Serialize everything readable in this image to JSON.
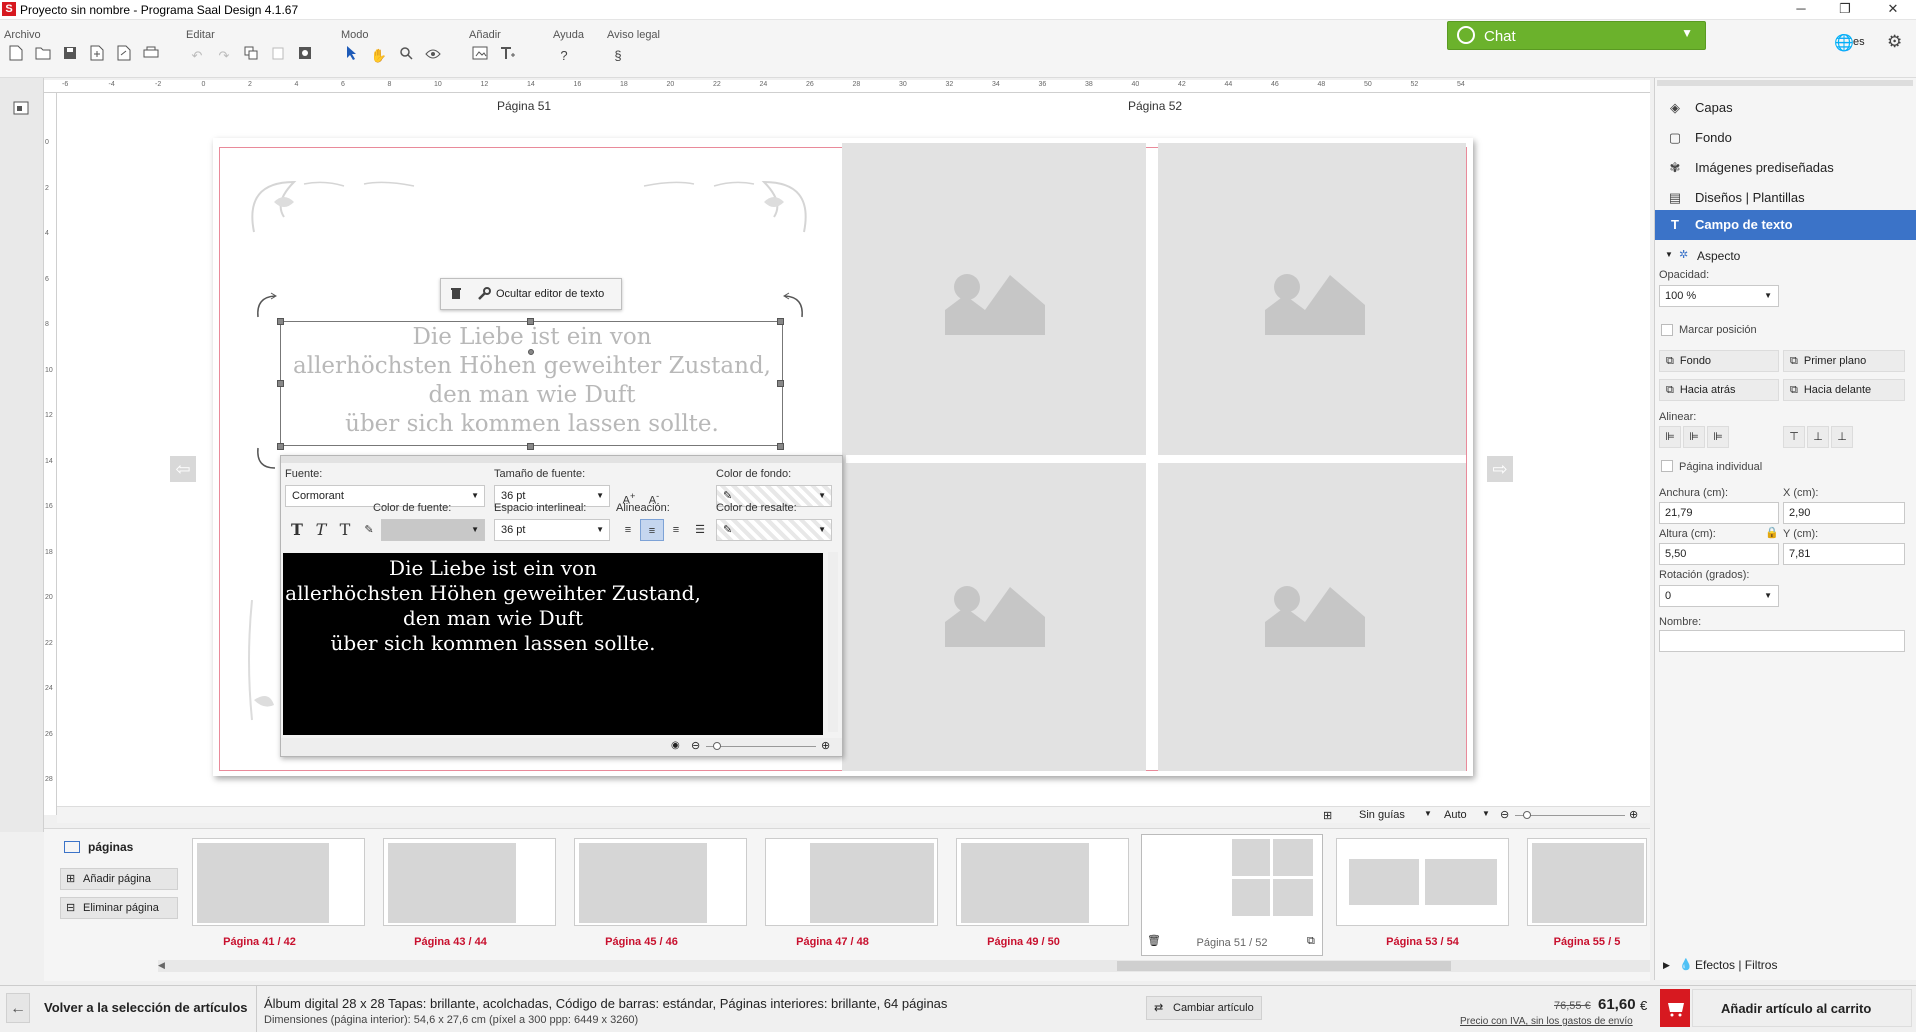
{
  "window": {
    "title": "Proyecto sin nombre - Programa Saal Design 4.1.67",
    "app_icon": "S",
    "minimize": "─",
    "restore": "❐",
    "close": "✕"
  },
  "menu": {
    "archivo": "Archivo",
    "editar": "Editar",
    "modo": "Modo",
    "anadir": "Añadir",
    "ayuda": "Ayuda",
    "aviso_legal": "Aviso legal",
    "ayuda_icon": "?",
    "aviso_icon": "§"
  },
  "chat": {
    "label": "Chat",
    "caret": "▼"
  },
  "lang": {
    "label": "es"
  },
  "ruler_top": [
    "-6",
    "-4",
    "-2",
    "0",
    "2",
    "4",
    "6",
    "8",
    "10",
    "12",
    "14",
    "16",
    "18",
    "20",
    "22",
    "24",
    "26",
    "28",
    "30",
    "32",
    "34",
    "36",
    "38",
    "40",
    "42",
    "44",
    "46",
    "48",
    "50",
    "52",
    "54"
  ],
  "ruler_left": [
    "0",
    "2",
    "4",
    "6",
    "8",
    "10",
    "12",
    "14",
    "16",
    "18",
    "20",
    "22",
    "24",
    "26",
    "28"
  ],
  "canvas": {
    "page_left": "Página 51",
    "page_right": "Página 52",
    "nav_left": "⇦",
    "nav_right": "⇨"
  },
  "textframe": {
    "lines": [
      "Die Liebe ist ein von",
      "allerhöchsten Höhen geweihter Zustand,",
      "den man wie Duft",
      "über sich kommen lassen sollte."
    ]
  },
  "hide_editor": {
    "label": "Ocultar editor de texto"
  },
  "editor": {
    "font_label": "Fuente:",
    "font_value": "Cormorant",
    "size_label": "Tamaño de fuente:",
    "size_value": "36 pt",
    "bg_color_label": "Color de fondo:",
    "font_color_label": "Color de fuente:",
    "line_spacing_label": "Espacio interlineal:",
    "line_spacing_value": "36 pt",
    "align_label": "Alineación:",
    "highlight_label": "Color de resalte:",
    "text_lines": [
      "Die Liebe ist ein von",
      "allerhöchsten Höhen geweihter Zustand,",
      "den man wie Duft",
      "über sich kommen lassen sollte."
    ]
  },
  "right_panel": {
    "items": [
      {
        "label": "Capas",
        "icon": "layers-icon"
      },
      {
        "label": "Fondo",
        "icon": "background-icon"
      },
      {
        "label": "Imágenes prediseñadas",
        "icon": "clipart-icon"
      },
      {
        "label": "Diseños | Plantillas",
        "icon": "templates-icon"
      },
      {
        "label": "Campo de texto",
        "icon": "text-field-icon"
      }
    ],
    "aspecto": "Aspecto",
    "opacidad_label": "Opacidad:",
    "opacidad_value": "100 %",
    "marcar_posicion": "Marcar posición",
    "btn_fondo": "Fondo",
    "btn_primer_plano": "Primer plano",
    "btn_hacia_atras": "Hacia atrás",
    "btn_hacia_delante": "Hacia delante",
    "alinear_label": "Alinear:",
    "pagina_individual": "Página individual",
    "anchura_label": "Anchura (cm):",
    "anchura_value": "21,79",
    "x_label": "X (cm):",
    "x_value": "2,90",
    "altura_label": "Altura (cm):",
    "altura_value": "5,50",
    "y_label": "Y (cm):",
    "y_value": "7,81",
    "rotacion_label": "Rotación (grados):",
    "rotacion_value": "0",
    "nombre_label": "Nombre:",
    "efectos": "Efectos | Filtros"
  },
  "canvas_footer": {
    "guides": "Sin guías",
    "zoom": "Auto"
  },
  "pages_panel": {
    "title": "páginas",
    "add": "Añadir página",
    "remove": "Eliminar página",
    "thumbs": [
      "Página 41 / 42",
      "Página 43 / 44",
      "Página 45 / 46",
      "Página 47 / 48",
      "Página 49 / 50",
      "Página 51 / 52",
      "Página 53 / 54",
      "Página 55 / 5"
    ]
  },
  "footer": {
    "back": "Volver a la selección de artículos",
    "product": "Álbum digital 28 x 28 Tapas: brillante, acolchadas, Código de barras: estándar, Páginas interiores: brillante, 64 páginas",
    "dimensions": "Dimensiones (página interior): 54,6 x 27,6 cm (píxel a 300 ppp: 6449 x 3260)",
    "change": "Cambiar artículo",
    "old_price": "76,55 €",
    "price": "61,60",
    "currency": "€",
    "price_note": "Precio con IVA, sin los gastos de envío",
    "add_cart": "Añadir artículo al carrito"
  }
}
